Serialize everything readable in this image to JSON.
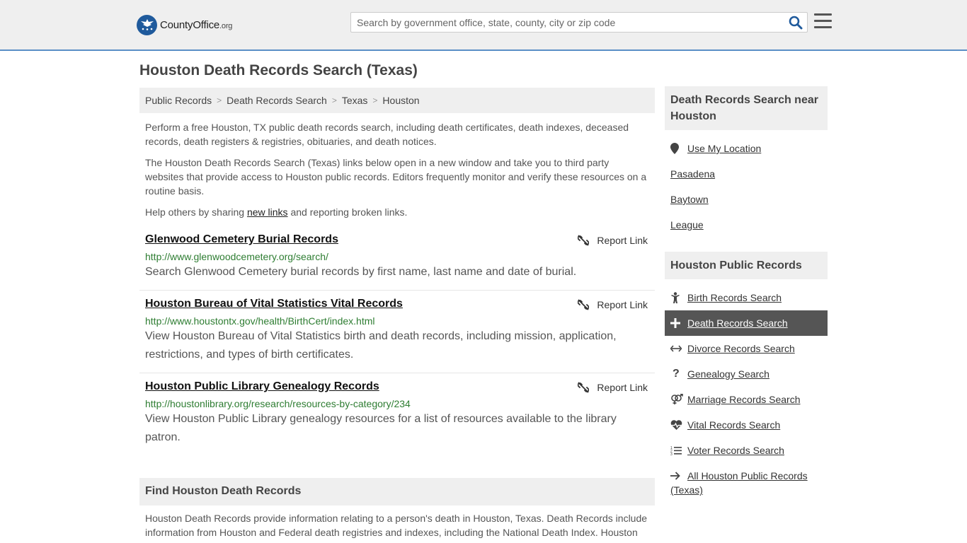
{
  "header": {
    "logo_main": "CountyOffice",
    "logo_suffix": ".org",
    "search_placeholder": "Search by government office, state, county, city or zip code"
  },
  "page_title": "Houston Death Records Search (Texas)",
  "breadcrumb": [
    "Public Records",
    "Death Records Search",
    "Texas",
    "Houston"
  ],
  "intro": {
    "p1": "Perform a free Houston, TX public death records search, including death certificates, death indexes, deceased records, death registers & registries, obituaries, and death notices.",
    "p2": "The Houston Death Records Search (Texas) links below open in a new window and take you to third party websites that provide access to Houston public records. Editors frequently monitor and verify these resources on a routine basis.",
    "p3_before": "Help others by sharing ",
    "p3_link": "new links",
    "p3_after": " and reporting broken links."
  },
  "report_label": "Report Link",
  "results": [
    {
      "title": "Glenwood Cemetery Burial Records",
      "url": "http://www.glenwoodcemetery.org/search/",
      "desc": "Search Glenwood Cemetery burial records by first name, last name and date of burial."
    },
    {
      "title": "Houston Bureau of Vital Statistics Vital Records",
      "url": "http://www.houstontx.gov/health/BirthCert/index.html",
      "desc": "View Houston Bureau of Vital Statistics birth and death records, including mission, application, restrictions, and types of birth certificates."
    },
    {
      "title": "Houston Public Library Genealogy Records",
      "url": "http://houstonlibrary.org/research/resources-by-category/234",
      "desc": "View Houston Public Library genealogy resources for a list of resources available to the library patron."
    }
  ],
  "find_section": {
    "heading": "Find Houston Death Records",
    "text": "Houston Death Records provide information relating to a person's death in Houston, Texas. Death Records include information from Houston and Federal death registries and indexes, including the National Death Index. Houston"
  },
  "sidebar": {
    "near_heading": "Death Records Search near Houston",
    "near_items": [
      "Use My Location",
      "Pasadena",
      "Baytown",
      "League"
    ],
    "public_heading": "Houston Public Records",
    "public_items": [
      {
        "label": "Birth Records Search",
        "icon": "child-icon"
      },
      {
        "label": "Death Records Search",
        "icon": "plus-icon"
      },
      {
        "label": "Divorce Records Search",
        "icon": "arrows-horizontal-icon"
      },
      {
        "label": "Genealogy Search",
        "icon": "question-icon"
      },
      {
        "label": "Marriage Records Search",
        "icon": "venus-mars-icon"
      },
      {
        "label": "Vital Records Search",
        "icon": "heartbeat-icon"
      },
      {
        "label": "Voter Records Search",
        "icon": "list-icon"
      },
      {
        "label": "All Houston Public Records (Texas)",
        "icon": "arrow-right-icon"
      }
    ]
  },
  "colors": {
    "header_bg": "#efefef",
    "header_border": "#5b8fc6",
    "logo_blue": "#1f5a9c",
    "search_icon": "#1f5a9c",
    "url_green": "#2e7d32",
    "active_bg": "#555555"
  }
}
